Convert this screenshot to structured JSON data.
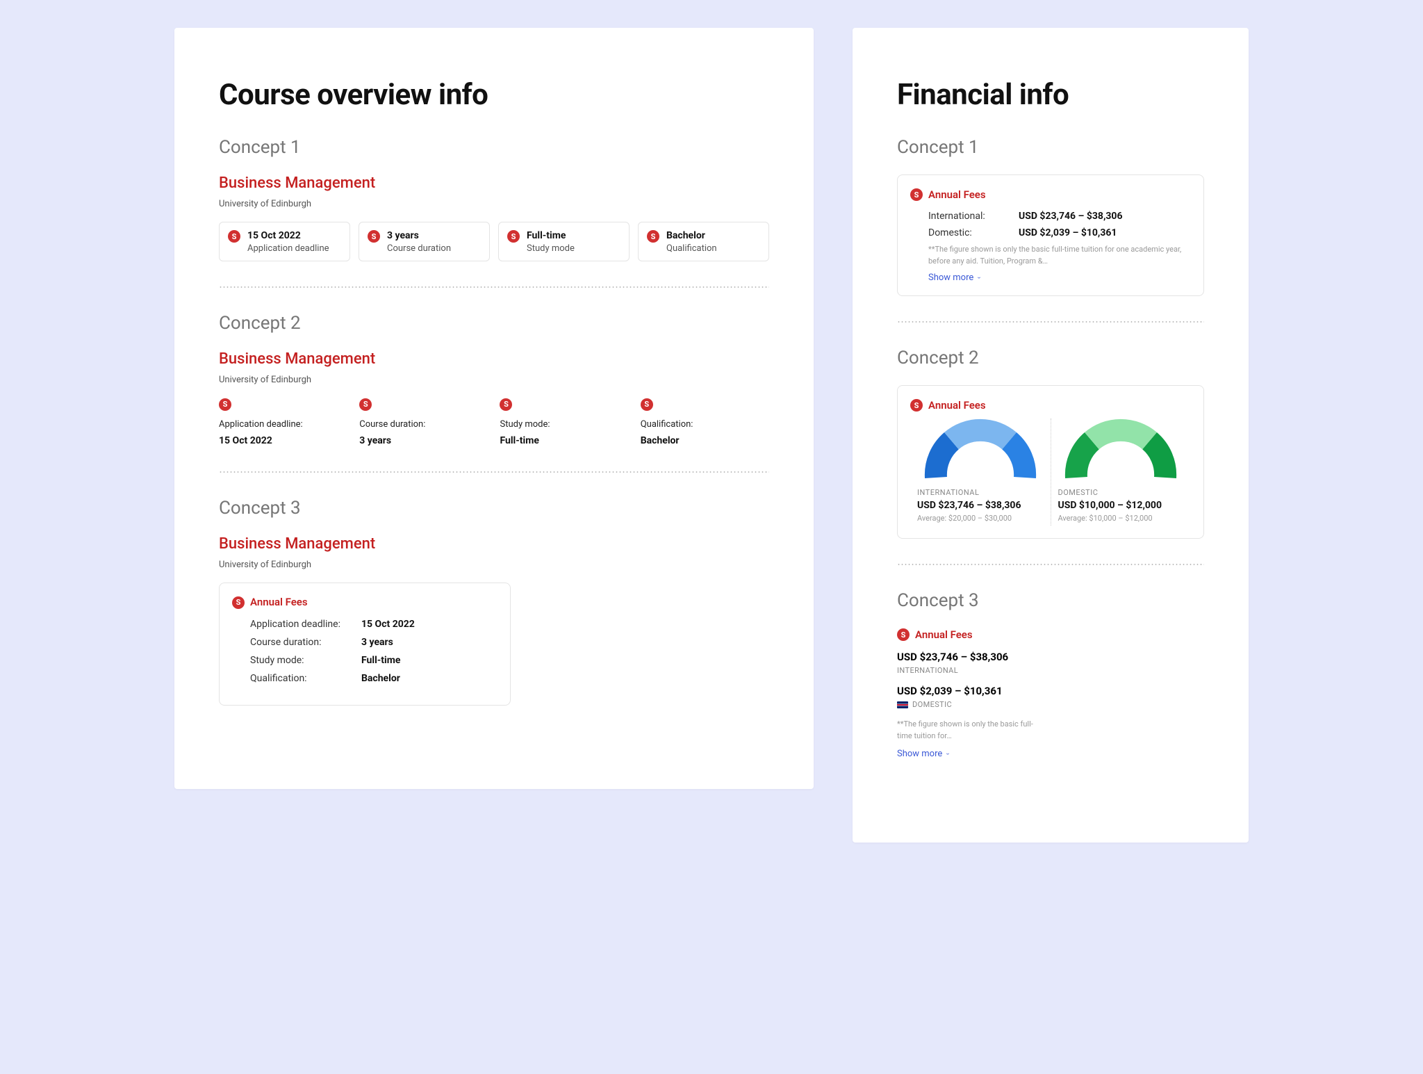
{
  "left": {
    "title": "Course overview info",
    "concept1": {
      "label": "Concept 1",
      "course_title": "Business Management",
      "university": "University of Edinburgh",
      "cards": [
        {
          "value": "15 Oct 2022",
          "label": "Application deadline"
        },
        {
          "value": "3 years",
          "label": "Course duration"
        },
        {
          "value": "Full-time",
          "label": "Study mode"
        },
        {
          "value": "Bachelor",
          "label": "Qualification"
        }
      ]
    },
    "concept2": {
      "label": "Concept 2",
      "course_title": "Business Management",
      "university": "University of Edinburgh",
      "cols": [
        {
          "label": "Application deadline:",
          "value": "15 Oct 2022"
        },
        {
          "label": "Course duration:",
          "value": "3 years"
        },
        {
          "label": "Study mode:",
          "value": "Full-time"
        },
        {
          "label": "Qualification:",
          "value": "Bachelor"
        }
      ]
    },
    "concept3": {
      "label": "Concept 3",
      "course_title": "Business Management",
      "university": "University of Edinburgh",
      "box_header": "Annual Fees",
      "rows": [
        {
          "k": "Application deadline:",
          "v": "15 Oct 2022"
        },
        {
          "k": "Course duration:",
          "v": "3 years"
        },
        {
          "k": "Study mode:",
          "v": "Full-time"
        },
        {
          "k": "Qualification:",
          "v": "Bachelor"
        }
      ]
    }
  },
  "right": {
    "title": "Financial info",
    "concept1": {
      "label": "Concept 1",
      "header": "Annual Fees",
      "rows": [
        {
          "k": "International:",
          "v": "USD $23,746 – $38,306"
        },
        {
          "k": "Domestic:",
          "v": "USD $2,039 – $10,361"
        }
      ],
      "disclaimer": "**The figure shown is only the basic full-time tuition for one academic year, before any aid. Tuition, Program &…",
      "show_more": "Show more"
    },
    "concept2": {
      "label": "Concept 2",
      "header": "Annual Fees",
      "intl": {
        "tag": "INTERNATIONAL",
        "value": "USD $23,746 – $38,306",
        "avg": "Average: $20,000 – $30,000"
      },
      "dom": {
        "tag": "DOMESTIC",
        "value": "USD $10,000 – $12,000",
        "avg": "Average: $10,000 – $12,000"
      }
    },
    "concept3": {
      "label": "Concept 3",
      "header": "Annual Fees",
      "intl_value": "USD $23,746 – $38,306",
      "intl_tag": "INTERNATIONAL",
      "dom_value": "USD $2,039 – $10,361",
      "dom_tag": "DOMESTIC",
      "disclaimer": "**The figure shown is only the basic full-time tuition for…",
      "show_more": "Show more"
    }
  }
}
